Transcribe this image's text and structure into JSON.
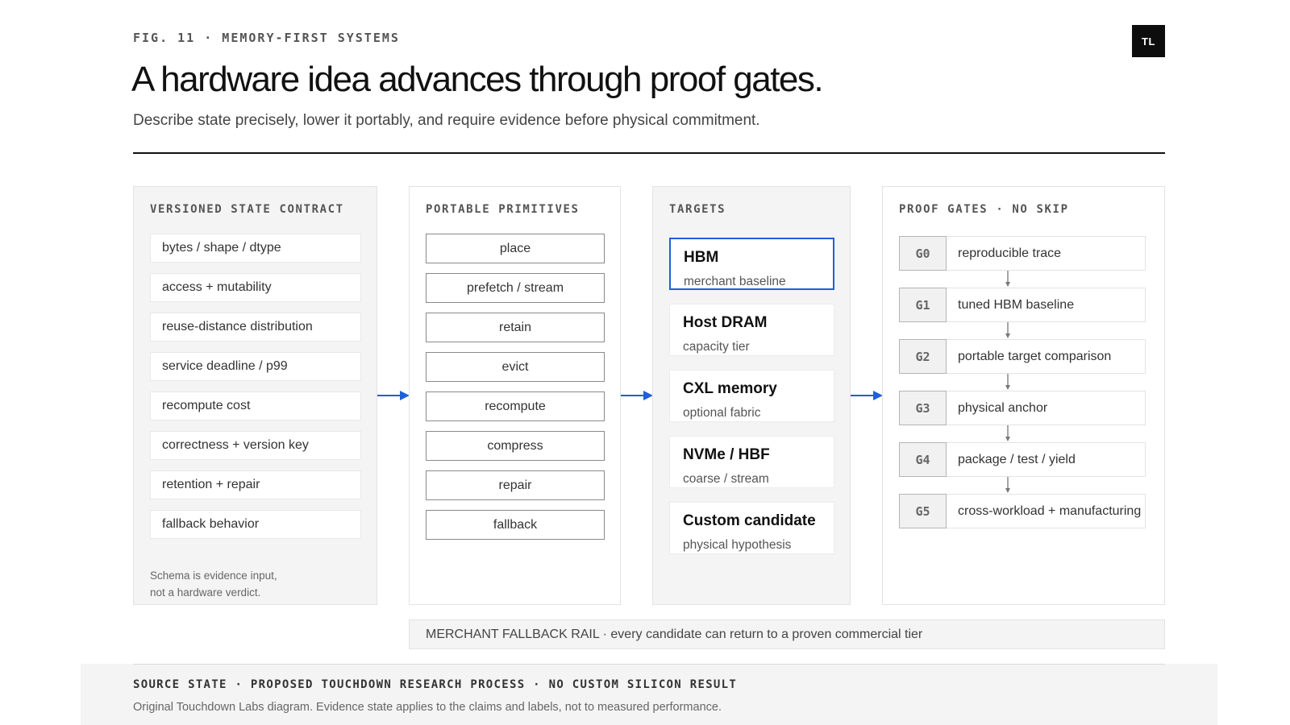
{
  "header": {
    "eyebrow": "FIG. 11 · MEMORY-FIRST SYSTEMS",
    "logo": "TL",
    "title": "A hardware idea advances through proof gates.",
    "subtitle": "Describe state precisely, lower it portably, and require evidence before physical commitment."
  },
  "contract": {
    "heading": "VERSIONED STATE CONTRACT",
    "items": [
      "bytes / shape / dtype",
      "access + mutability",
      "reuse-distance distribution",
      "service deadline / p99",
      "recompute cost",
      "correctness + version key",
      "retention + repair",
      "fallback behavior"
    ],
    "note_line1": "Schema is evidence input,",
    "note_line2": "not a hardware verdict."
  },
  "primitives": {
    "heading": "PORTABLE PRIMITIVES",
    "items": [
      "place",
      "prefetch / stream",
      "retain",
      "evict",
      "recompute",
      "compress",
      "repair",
      "fallback"
    ]
  },
  "targets": {
    "heading": "TARGETS",
    "items": [
      {
        "name": "HBM",
        "sub": "merchant baseline",
        "active": true
      },
      {
        "name": "Host DRAM",
        "sub": "capacity tier",
        "active": false
      },
      {
        "name": "CXL memory",
        "sub": "optional fabric",
        "active": false
      },
      {
        "name": "NVMe / HBF",
        "sub": "coarse / stream",
        "active": false
      },
      {
        "name": "Custom candidate",
        "sub": "physical hypothesis",
        "active": false
      }
    ]
  },
  "gates": {
    "heading": "PROOF GATES · NO SKIP",
    "items": [
      {
        "id": "G0",
        "label": "reproducible trace"
      },
      {
        "id": "G1",
        "label": "tuned HBM baseline"
      },
      {
        "id": "G2",
        "label": "portable target comparison"
      },
      {
        "id": "G3",
        "label": "physical anchor"
      },
      {
        "id": "G4",
        "label": "package / test / yield"
      },
      {
        "id": "G5",
        "label": "cross-workload + manufacturing"
      }
    ]
  },
  "rail": "MERCHANT FALLBACK RAIL · every candidate can return to a proven commercial tier",
  "footer": {
    "state": "SOURCE STATE · PROPOSED TOUCHDOWN RESEARCH PROCESS · NO CUSTOM SILICON RESULT",
    "note": "Original Touchdown Labs diagram. Evidence state applies to the claims and labels, not to measured performance."
  },
  "colors": {
    "accent": "#1f5fd8",
    "ink": "#111111",
    "panel": "#f4f4f4"
  }
}
